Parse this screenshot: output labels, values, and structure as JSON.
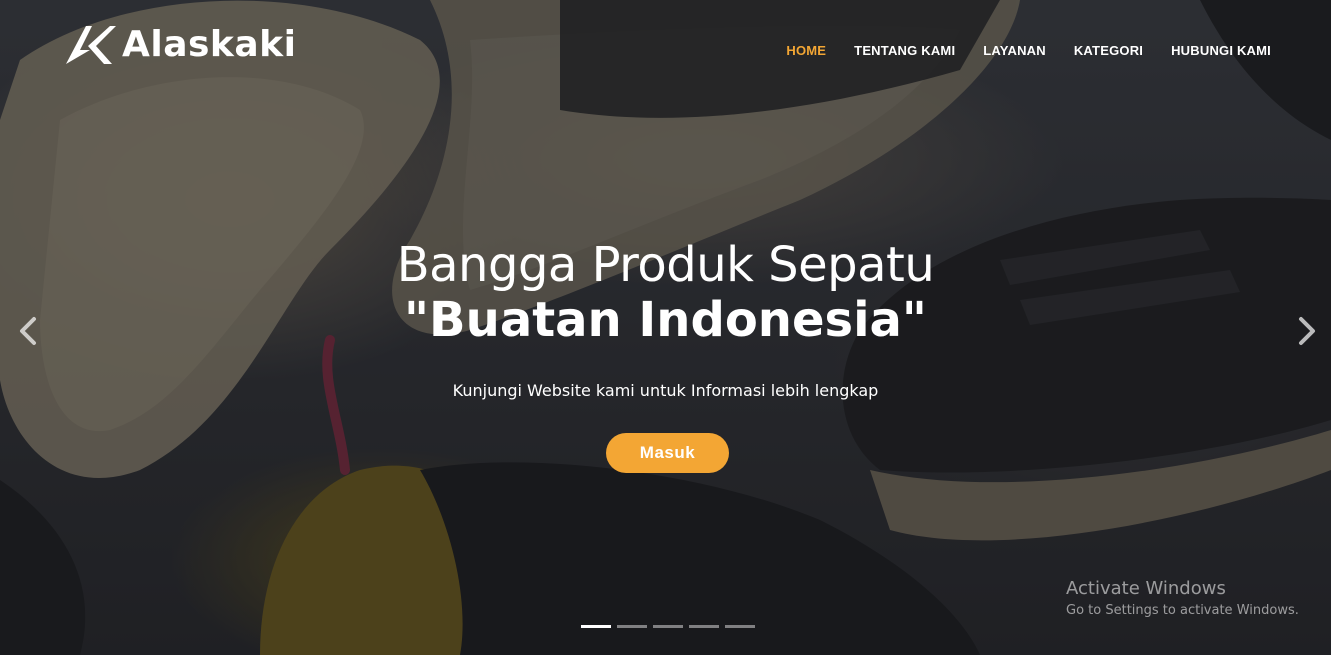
{
  "brand": {
    "name": "Alaskaki",
    "logo_icon": "ak-monogram-icon"
  },
  "nav": {
    "items": [
      {
        "label": "HOME",
        "active": true
      },
      {
        "label": "TENTANG KAMI",
        "active": false
      },
      {
        "label": "LAYANAN",
        "active": false
      },
      {
        "label": "KATEGORI",
        "active": false
      },
      {
        "label": "HUBUNGI KAMI",
        "active": false
      }
    ]
  },
  "hero": {
    "headline_line1": "Bangga Produk Sepatu",
    "headline_line2": "\"Buatan Indonesia\"",
    "subtitle": "Kunjungi Website kami untuk Informasi lebih lengkap",
    "cta_label": "Masuk",
    "background": "shoes-photo",
    "prev_icon": "chevron-left-icon",
    "next_icon": "chevron-right-icon",
    "slide_count": 5,
    "active_slide": 1
  },
  "watermark": {
    "title": "Activate Windows",
    "subtitle": "Go to Settings to activate Windows."
  },
  "colors": {
    "accent": "#f3a634",
    "text": "#ffffff"
  }
}
